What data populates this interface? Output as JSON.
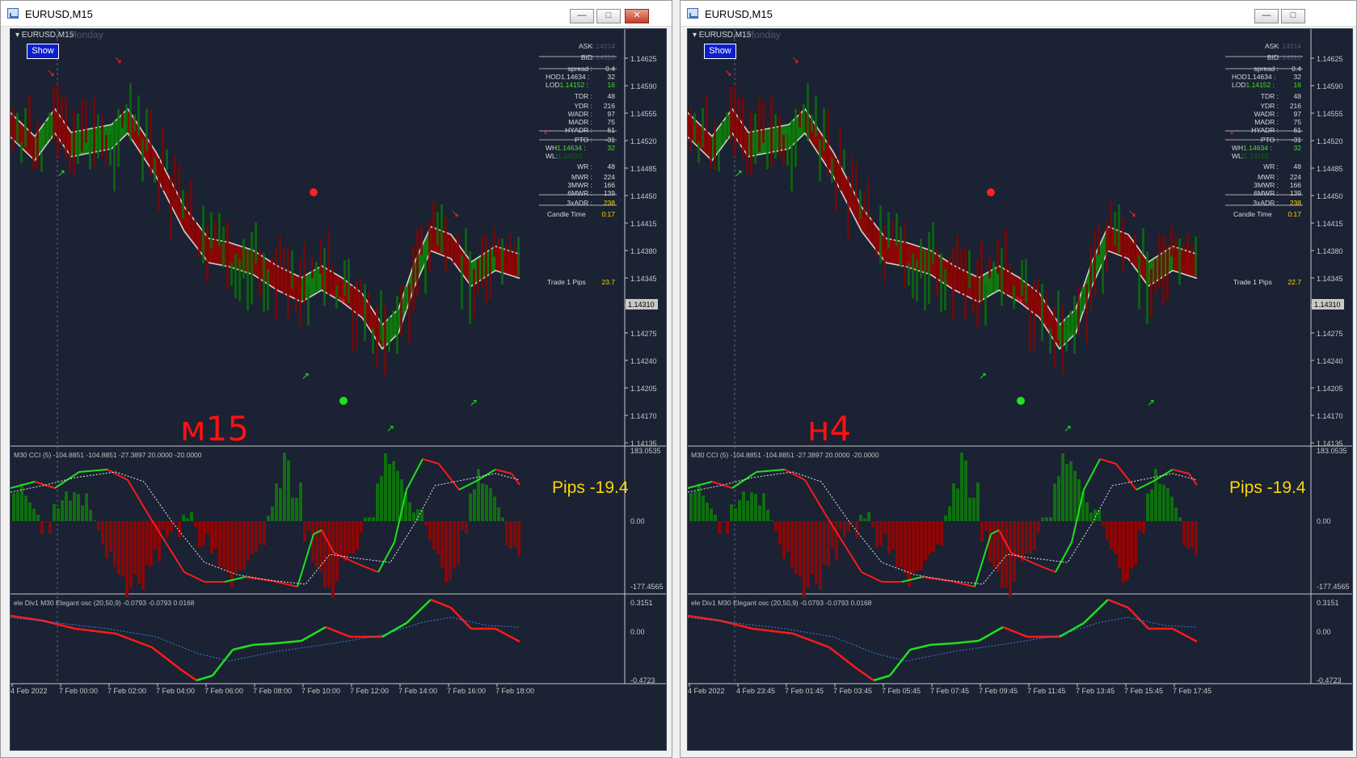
{
  "colors": {
    "bull": "#0f7a10",
    "bear": "#8a0707",
    "bg": "#1a2233",
    "grid": "#3b4458",
    "text": "#c8c8c8",
    "white": "#ffffff",
    "yellow": "#ffd500",
    "green": "#3ee620",
    "red": "#ff1a1a"
  },
  "windows": [
    {
      "title": "EURUSD,M15",
      "chart_label": "EURUSD,M15",
      "day_label": "Monday",
      "show_button": "Show",
      "big_tag": "м15",
      "pips_label": "Pips -19.4",
      "price_axis": [
        "1.14625",
        "1.14590",
        "1.14555",
        "1.14520",
        "1.14485",
        "1.14450",
        "1.14415",
        "1.14380",
        "1.14345",
        "1.14310",
        "1.14275",
        "1.14240",
        "1.14205",
        "1.14170",
        "1.14135"
      ],
      "current_price": "1.14310",
      "time_axis": [
        "4 Feb 2022",
        "7 Feb 00:00",
        "7 Feb 02:00",
        "7 Feb 04:00",
        "7 Feb 06:00",
        "7 Feb 08:00",
        "7 Feb 10:00",
        "7 Feb 12:00",
        "7 Feb 14:00",
        "7 Feb 16:00",
        "7 Feb 18:00"
      ],
      "cci_label": "M30 CCI (5) -104.8851 -104.8851 -27.3897 20.0000 -20.0000",
      "cci_axis": [
        "183.0535",
        "0.00",
        "-177.4565"
      ],
      "osc_label": "ele Div1 M30 Elegant osc (20,50,9) -0.0793 -0.0793 0.0168",
      "osc_axis": [
        "0.3151",
        "0.00",
        "-0.4723"
      ],
      "trade_label": "Trade 1 Pips",
      "trade_value": "23.7",
      "info": {
        "ask_label": "ASK",
        "ask": "1.14314",
        "bid_label": "BID",
        "bid": "1.14310",
        "spread_label": "spread :",
        "spread": "0.4",
        "hod_label": "HOD",
        "hod_price": "1.14634",
        "hod_sep": " :",
        "hod": "32",
        "lod_label": "LOD",
        "lod_price": "1.14152",
        "lod_sep": " :",
        "lod": "16",
        "tdr_label": "TDR :",
        "tdr": "48",
        "ydr_label": "YDR :",
        "ydr": "216",
        "wadr_label": "WADR :",
        "wadr": "97",
        "madr_label": "MADR :",
        "madr": "75",
        "hyadr_label": "HYADR :",
        "hyadr": "61",
        "pto_label": "PTO :",
        "pto": "-31",
        "wh_label": "WH",
        "wh_price": "1.14634",
        "wh_sep": " :",
        "wh": "32",
        "wl_label": "WL:",
        "wl_price": "1.14152",
        "wr_label": "WR :",
        "wr": "48",
        "mwr_label": "MWR :",
        "mwr": "224",
        "m3_label": "3MWR :",
        "m3": "166",
        "m6_label": "6MWR :",
        "m6": "139",
        "adr3_label": "3xADR :",
        "adr3": "238",
        "candle_label": "Candle Time",
        "candle": "0:17"
      }
    },
    {
      "title": "EURUSD,M15",
      "chart_label": "EURUSD,M15",
      "day_label": "Monday",
      "show_button": "Show",
      "big_tag": "н4",
      "pips_label": "Pips -19.4",
      "price_axis": [
        "1.14625",
        "1.14590",
        "1.14555",
        "1.14520",
        "1.14485",
        "1.14450",
        "1.14415",
        "1.14380",
        "1.14345",
        "1.14310",
        "1.14275",
        "1.14240",
        "1.14205",
        "1.14170",
        "1.14135"
      ],
      "current_price": "1.14310",
      "time_axis": [
        "4 Feb 2022",
        "4 Feb 23:45",
        "7 Feb 01:45",
        "7 Feb 03:45",
        "7 Feb 05:45",
        "7 Feb 07:45",
        "7 Feb 09:45",
        "7 Feb 11:45",
        "7 Feb 13:45",
        "7 Feb 15:45",
        "7 Feb 17:45"
      ],
      "cci_label": "M30 CCI (5) -104.8851 -104.8851 -27.3897 20.0000 -20.0000",
      "cci_axis": [
        "183.0535",
        "0.00",
        "-177.4565"
      ],
      "osc_label": "ele Div1 M30 Elegant osc (20,50,9) -0.0793 -0.0793 0.0168",
      "osc_axis": [
        "0.3151",
        "0.00",
        "-0.4723"
      ],
      "trade_label": "Trade 1 Pips",
      "trade_value": "22.7",
      "info": {
        "ask_label": "ASK",
        "ask": "1.14314",
        "bid_label": "BID",
        "bid": "1.14310",
        "spread_label": "spread :",
        "spread": "0.4",
        "hod_label": "HOD",
        "hod_price": "1.14634",
        "hod_sep": " :",
        "hod": "32",
        "lod_label": "LOD",
        "lod_price": "1.14152",
        "lod_sep": " :",
        "lod": "16",
        "tdr_label": "TDR :",
        "tdr": "48",
        "ydr_label": "YDR :",
        "ydr": "216",
        "wadr_label": "WADR :",
        "wadr": "97",
        "madr_label": "MADR :",
        "madr": "75",
        "hyadr_label": "HYADR :",
        "hyadr": "61",
        "pto_label": "PTO :",
        "pto": "-31",
        "wh_label": "WH",
        "wh_price": "1.14634",
        "wh_sep": " :",
        "wh": "32",
        "wl_label": "WL:",
        "wl_price": "1.14152",
        "wr_label": "WR :",
        "wr": "48",
        "mwr_label": "MWR :",
        "mwr": "224",
        "m3_label": "3MWR :",
        "m3": "166",
        "m6_label": "6MWR :",
        "m6": "139",
        "adr3_label": "3xADR :",
        "adr3": "238",
        "candle_label": "Candle Time",
        "candle": "0:17"
      }
    }
  ]
}
